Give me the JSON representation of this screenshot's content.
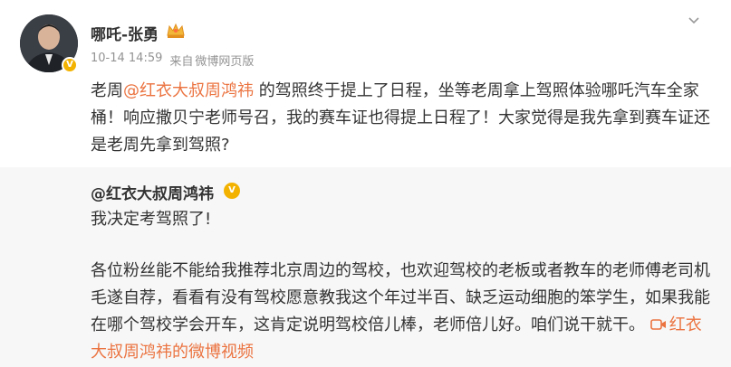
{
  "post": {
    "author": "哪吒-张勇",
    "time": "10-14 14:59",
    "source_prefix": "来自",
    "source": "微博网页版",
    "text_before": "老周",
    "mention": "@红衣大叔周鸿祎",
    "text_after": " 的驾照终于提上了日程，坐等老周拿上驾照体验哪吒汽车全家桶！响应撒贝宁老师号召，我的赛车证也得提上日程了！大家觉得是我先拿到赛车证还是老周先拿到驾照?"
  },
  "quote": {
    "author": "@红衣大叔周鸿祎",
    "line1": "我决定考驾照了!",
    "body": "各位粉丝能不能给我推荐北京周边的驾校，也欢迎驾校的老板或者教车的老师傅老司机毛遂自荐，看看有没有驾校愿意教我这个年过半百、缺乏运动细胞的笨学生，如果我能在哪个驾校学会开车，这肯定说明驾校倍儿棒，老师倍儿好。咱们说干就干。",
    "video_link": "红衣大叔周鸿祎的微博视频"
  },
  "colors": {
    "accent": "#eb7340",
    "meta": "#939393",
    "quote_bg": "#f7f7f7",
    "verified": "#f3b200"
  },
  "icons": {
    "avatar": "avatar",
    "verified": "verified-badge-icon",
    "crown": "crown-icon",
    "more": "chevron-down-icon",
    "video": "video-icon"
  }
}
